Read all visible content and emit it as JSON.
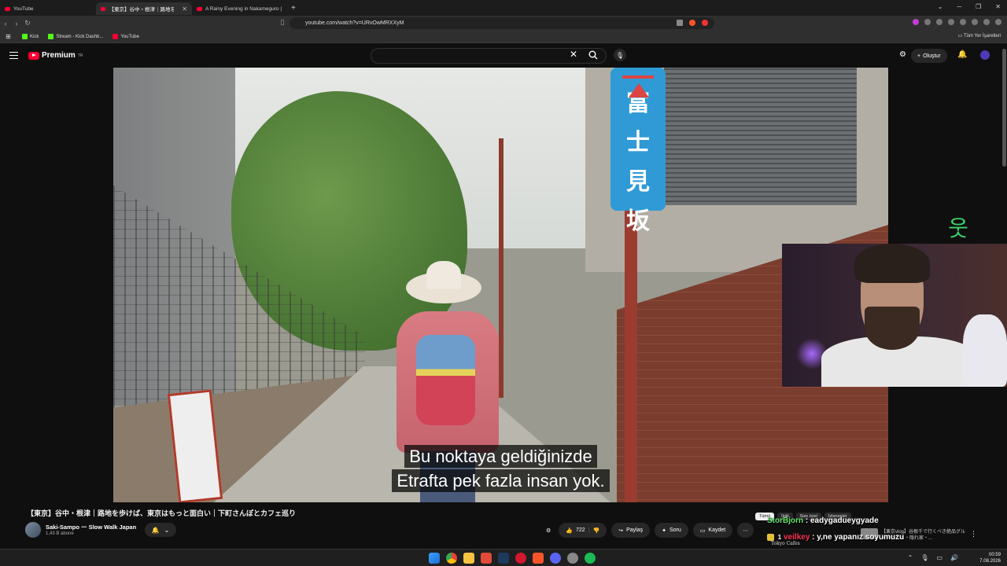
{
  "browser": {
    "tabs": [
      {
        "label": "YouTube"
      },
      {
        "label": "【東京】谷中・根津｜路地を歩け"
      },
      {
        "label": "A Rainy Evening in Nakameguro | Lo"
      }
    ],
    "url": "youtube.com/watch?v=URvOwMRXXyM",
    "bookmarks": [
      {
        "label": "Kick",
        "color": "#53fc18"
      },
      {
        "label": "Stream - Kick Dashb...",
        "color": "#53fc18"
      },
      {
        "label": "YouTube",
        "color": "#ff0033"
      }
    ],
    "bookmarks_right": "Tüm Yer İşaretleri"
  },
  "youtube": {
    "logo_text": "Premium",
    "logo_region": "TR",
    "create_label": "Oluştur"
  },
  "video": {
    "sign_chars": [
      "富",
      "士",
      "見",
      "坂"
    ],
    "subtitle_line1": "Bu noktaya geldiğinizde",
    "subtitle_line2": "Etrafta pek fazla insan yok.",
    "title": "【東京】谷中・根津｜路地を歩けば、東京はもっと面白い｜下町さんぽとカフェ巡り",
    "channel": "Saki-Sampo ー Slow Walk Japan",
    "subscribers": "1,43 B abone",
    "likes": "722",
    "share_label": "Paylaş",
    "ask_label": "Soru",
    "save_label": "Kaydet"
  },
  "chat": {
    "tabs": [
      "Tümü",
      "İlgili",
      "Size özel",
      "İzlenenler"
    ],
    "msg1_user": "StorBjorn",
    "msg1_text": ": eadygadueygyade",
    "msg2_user": "veilkey",
    "msg2_text": ": y,ne yapanız soyumuzu",
    "msg2_badge": "1",
    "overlay_text": "Tokyo Cafes",
    "rec_text": "【東京vlog】谷根千で行くべき絶品グルメ・カフェ・隠れ家・..."
  },
  "taskbar": {
    "time": "00:59",
    "date": "7.08.2026"
  },
  "colors": {
    "youtube_red": "#ff0033",
    "chat_user1": "#66e36e",
    "chat_user2": "#ff3355",
    "sign_blue": "#2f9ad5"
  }
}
